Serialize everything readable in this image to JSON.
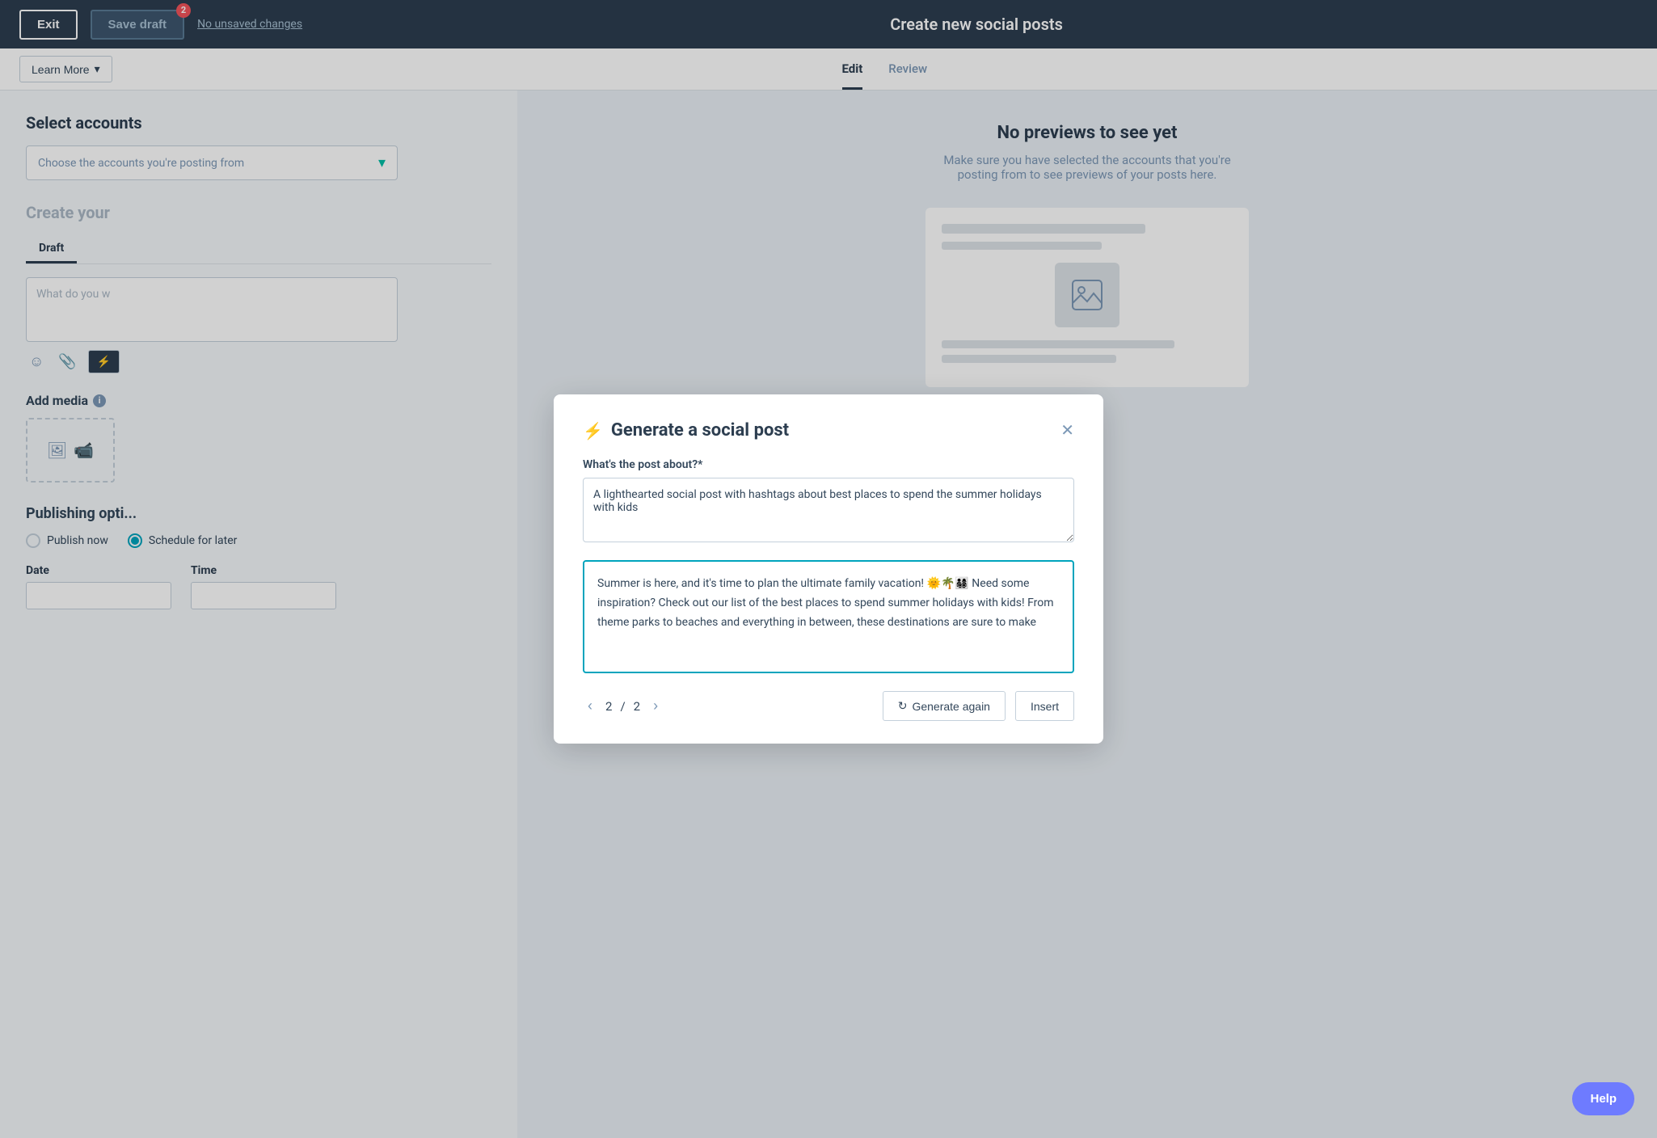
{
  "topbar": {
    "exit_label": "Exit",
    "save_draft_label": "Save draft",
    "notification_count": "2",
    "no_unsaved_label": "No unsaved changes",
    "title": "Create new social posts"
  },
  "subnav": {
    "learn_more_label": "Learn More",
    "tabs": [
      {
        "id": "edit",
        "label": "Edit",
        "active": true
      },
      {
        "id": "review",
        "label": "Review",
        "active": false
      }
    ]
  },
  "left_panel": {
    "select_accounts_title": "Select accounts",
    "account_placeholder": "Choose the accounts you're posting from",
    "create_section_title": "Create yo",
    "draft_tab_label": "Draft",
    "post_placeholder": "What do you w",
    "add_media_title": "Add media",
    "publishing_title": "Publishing opti...",
    "publish_now_label": "Publish now",
    "schedule_later_label": "Schedule for later",
    "date_label": "Date",
    "time_label": "Time"
  },
  "right_panel": {
    "no_preview_title": "No previews to see yet",
    "no_preview_subtitle": "Make sure you have selected the accounts that you're posting from to see previews of your posts here."
  },
  "modal": {
    "title": "Generate a social post",
    "topic_label": "What's the post about?*",
    "topic_value": "A lighthearted social post with hashtags about best places to spend the summer holidays with kids",
    "generated_text": "Summer is here, and it's time to plan the ultimate family vacation! 🌞🌴👨‍👩‍👧‍👦 Need some inspiration? Check out our list of the best places to spend summer holidays with kids! From theme parks to beaches and everything in between, these destinations are sure to make",
    "pagination_current": "2",
    "pagination_total": "2",
    "generate_again_label": "Generate again",
    "insert_label": "Insert"
  },
  "help": {
    "label": "Help"
  }
}
